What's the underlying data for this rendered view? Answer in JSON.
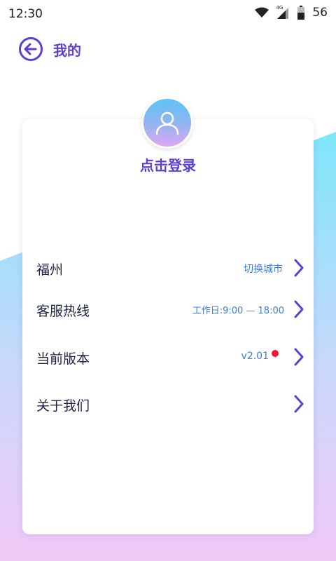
{
  "status_bar": {
    "time": "12:30",
    "network": "4G",
    "battery": "56",
    "icons": [
      "wifi-icon",
      "signal-icon",
      "battery-icon"
    ]
  },
  "header": {
    "back_icon": "arrow-left-circle-icon",
    "title": "我的"
  },
  "profile": {
    "avatar_icon": "user-icon",
    "login_label": "点击登录"
  },
  "menu": [
    {
      "label": "福州",
      "value": "切换城市",
      "icon": "chevron-right-icon"
    },
    {
      "label": "客服热线",
      "value": "工作日:9:00 — 18:00",
      "icon": "chevron-right-icon"
    },
    {
      "label": "当前版本",
      "value": "v2.01",
      "badge": "red-dot",
      "icon": "chevron-right-icon"
    },
    {
      "label": "关于我们",
      "value": "",
      "icon": "chevron-right-icon"
    }
  ],
  "colors": {
    "accent": "#5b3fd6",
    "link": "#3d7dd8",
    "badge": "#f01a33",
    "gradient_top": "#7fe0f7",
    "gradient_bottom": "#efc8f7"
  }
}
